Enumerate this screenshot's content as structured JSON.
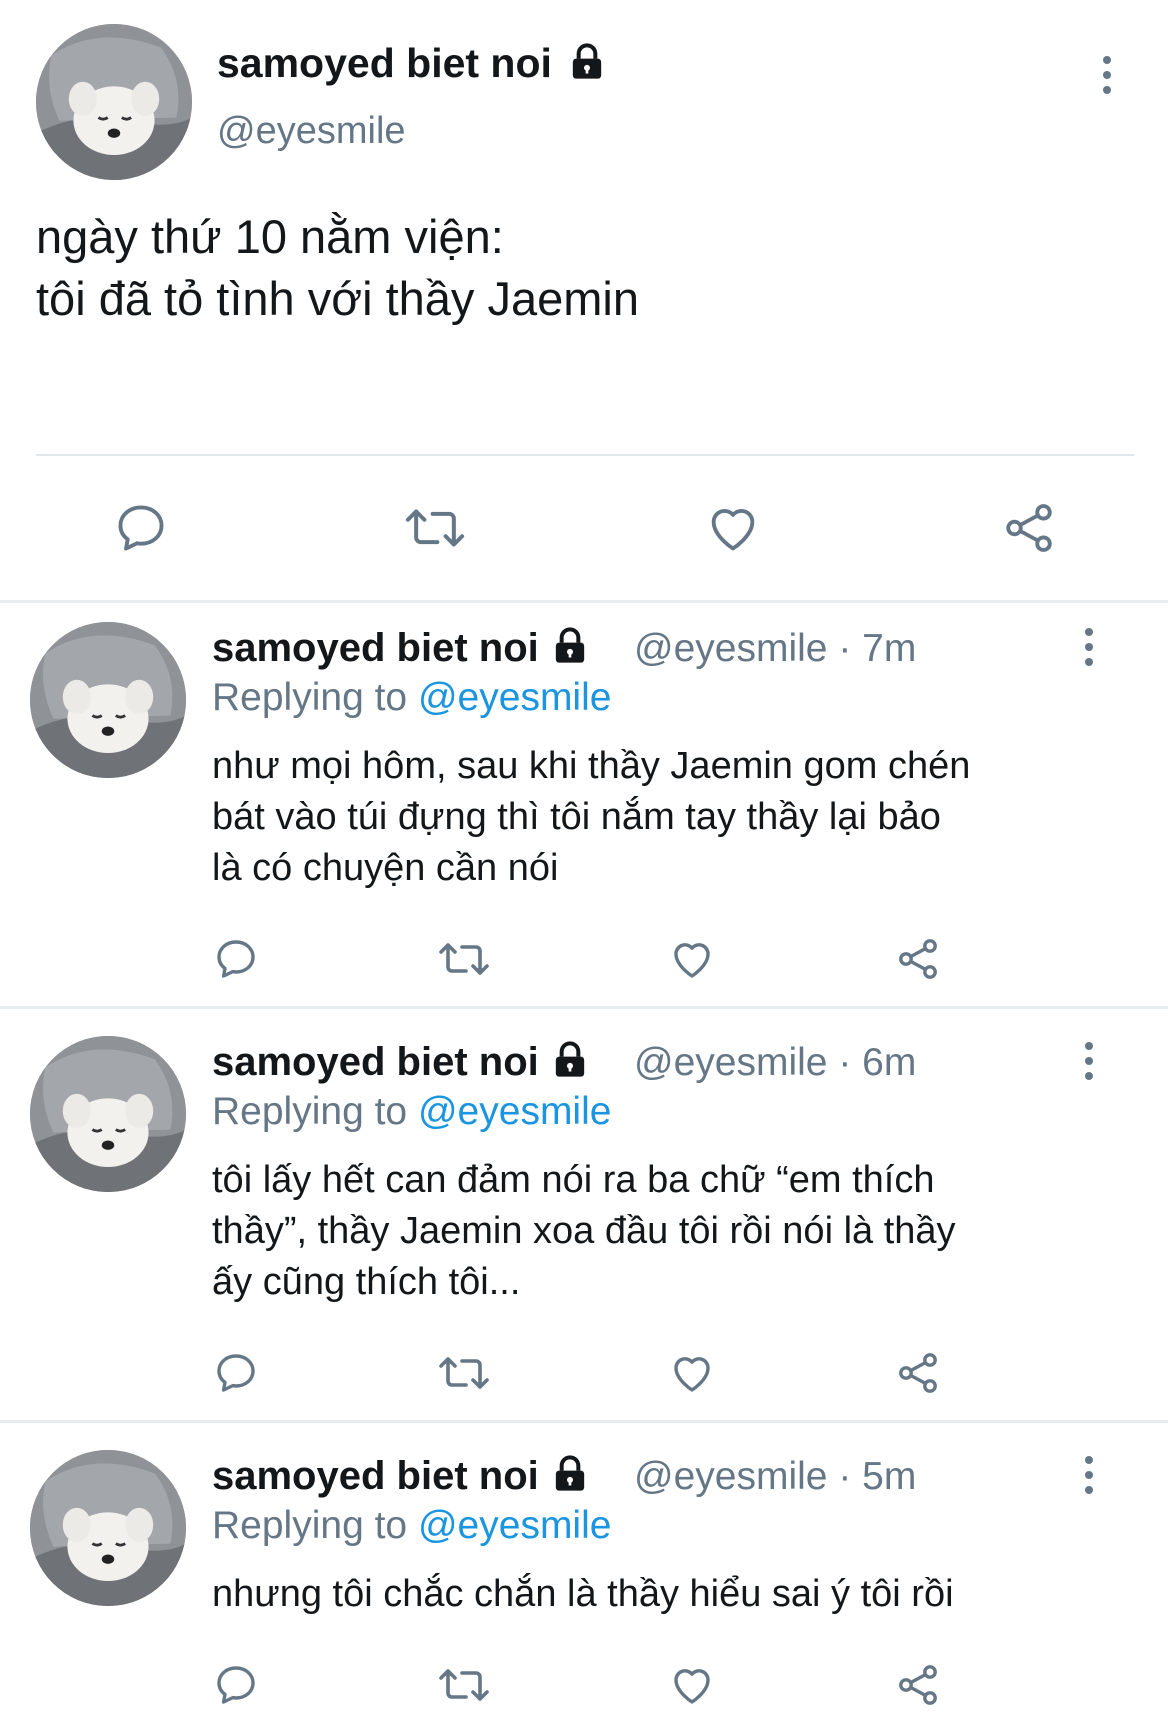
{
  "main_tweet": {
    "display_name": "samoyed biet noi",
    "handle": "@eyesmile",
    "text_line1": "ngày thứ 10 nằm viện:",
    "text_line2": "tôi đã tỏ tình với thầy Jaemin",
    "locked": true
  },
  "replies": [
    {
      "display_name": "samoyed biet noi",
      "handle": "@eyesmile",
      "time": "7m",
      "replying_prefix": "Replying to",
      "replying_to": "@eyesmile",
      "lines": [
        "như mọi hôm, sau khi thầy Jaemin gom chén",
        "bát vào túi đựng thì tôi nắm tay thầy lại bảo",
        "là có chuyện cần nói"
      ]
    },
    {
      "display_name": "samoyed biet noi",
      "handle": "@eyesmile",
      "time": "6m",
      "replying_prefix": "Replying to",
      "replying_to": "@eyesmile",
      "lines": [
        "tôi lấy hết can đảm nói ra ba chữ “em thích",
        "thầy”, thầy Jaemin xoa đầu tôi rồi nói là thầy",
        "ấy cũng thích tôi..."
      ]
    },
    {
      "display_name": "samoyed biet noi",
      "handle": "@eyesmile",
      "time": "5m",
      "replying_prefix": "Replying to",
      "replying_to": "@eyesmile",
      "lines": [
        "nhưng tôi chắc chắn là thầy hiểu sai ý tôi rồi"
      ]
    }
  ],
  "meta_separator": "·",
  "icons": {
    "reply": "reply-icon",
    "retweet": "retweet-icon",
    "like": "heart-icon",
    "share": "share-icon",
    "more": "more-vertical-icon",
    "lock": "lock-icon"
  },
  "colors": {
    "text": "#14171a",
    "secondary": "#657786",
    "link": "#1b95e0",
    "divider": "#e1e8ed"
  }
}
